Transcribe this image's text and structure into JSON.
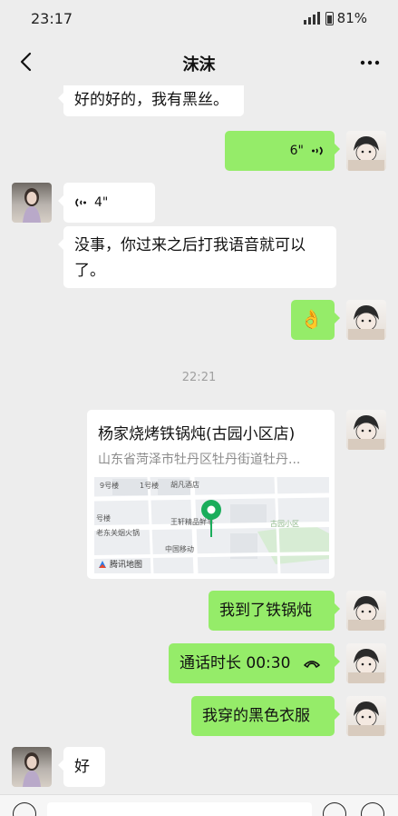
{
  "status_bar": {
    "time": "23:17",
    "battery": "81%"
  },
  "nav": {
    "title": "沫沫"
  },
  "messages": {
    "m1": "好的好的，我有黑丝。",
    "m2_voice": "6\"",
    "m3_voice": "4\"",
    "m4": "没事，你过来之后打我语音就可以了。",
    "m5_emoji": "👌",
    "time_sep": "22:21",
    "location": {
      "title": "杨家烧烤铁锅炖(古园小区店)",
      "address": "山东省菏泽市牡丹区牡丹街道牡丹...",
      "map_labels": {
        "l1": "9号楼",
        "l2": "1号楼",
        "l3": "胡凡酒店",
        "l4": "号楼",
        "l5": "王轩精品鲜羊",
        "l6": "老东关烟火锅",
        "l7": "中国移动",
        "l8": "古园小区"
      },
      "map_logo": "腾讯地图"
    },
    "m6": "我到了铁锅炖",
    "m7_call": "通话时长 00:30",
    "m8": "我穿的黑色衣服",
    "m9": "好"
  },
  "colors": {
    "outgoing": "#95ec69",
    "incoming": "#ffffff",
    "background": "#ededed",
    "pin": "#1aad5b"
  }
}
